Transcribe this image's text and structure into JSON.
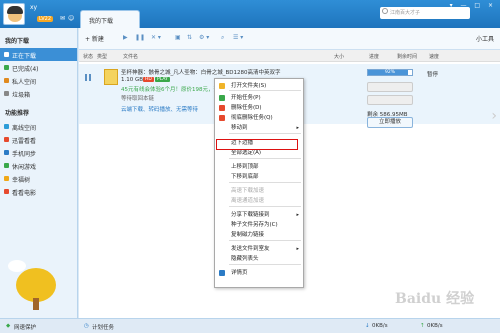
{
  "titlebar": {
    "username": "xy",
    "level": "LV22",
    "tab_label": "我的下载",
    "search_placeholder": "江南百大才子",
    "window_controls": "▾ — □ ×"
  },
  "toolbar": {
    "new_label": "+ 新建",
    "tools_label": "小工具"
  },
  "columns": {
    "status": "状态",
    "type": "类型",
    "filename": "文件名",
    "size": "大小",
    "progress": "进度",
    "remaining": "剩余时间",
    "speed": "速度"
  },
  "sidebar": {
    "section1": "我的下载",
    "items": [
      {
        "label": "正在下载",
        "icon": "download-icon",
        "color": "#2b7bc5"
      },
      {
        "label": "已完成(4)",
        "icon": "check-icon",
        "color": "#3aa84a"
      },
      {
        "label": "私人空间",
        "icon": "lock-icon",
        "color": "#e08a1e"
      },
      {
        "label": "垃圾箱",
        "icon": "trash-icon",
        "color": "#888888"
      }
    ],
    "section2": "功能推荐",
    "features": [
      {
        "label": "离线空间",
        "icon": "cloud-icon",
        "color": "#2b9cd8"
      },
      {
        "label": "迅雷看看",
        "icon": "play-icon",
        "color": "#e6492d"
      },
      {
        "label": "手机同步",
        "icon": "phone-icon",
        "color": "#2b7bc5"
      },
      {
        "label": "休闲游戏",
        "icon": "game-icon",
        "color": "#3aa84a"
      },
      {
        "label": "幸福树",
        "icon": "tree-icon",
        "color": "#f0a818"
      },
      {
        "label": "看看电影",
        "icon": "movie-icon",
        "color": "#e6492d"
      }
    ]
  },
  "task": {
    "title": "圣杯神器：骸骨之城_凡人圣物：白骨之城_BD1280高清中英双字",
    "size": "1.10 GB",
    "tag_hd": "HD",
    "tag_play": "PLAY",
    "line1": "45元有线会体验6个月！原价198元，预约",
    "line2": "等待取回本链",
    "line3": "云端下载、转码播放、无需等待",
    "progress_percent": 92,
    "progress_text": "92%",
    "status": "暂停",
    "remaining": "剩余 586.95MB",
    "play_label": "立即播放"
  },
  "context_menu": {
    "items": [
      {
        "label": "打开文件夹(S)",
        "disabled": false,
        "icon": "folder-icon"
      },
      {
        "label": "开始任务(P)",
        "disabled": false,
        "icon": "play-icon"
      },
      {
        "label": "删除任务(D)",
        "disabled": false,
        "icon": "delete-icon"
      },
      {
        "label": "彻底删除任务(Q)",
        "disabled": false,
        "icon": "delete-all-icon"
      },
      {
        "label": "移动到",
        "disabled": false,
        "icon": "",
        "submenu": true
      },
      {
        "label": "边下边播",
        "disabled": false,
        "icon": "",
        "highlighted": true
      },
      {
        "label": "全部选定(A)",
        "disabled": false,
        "icon": ""
      },
      {
        "label": "上移到顶部",
        "disabled": false,
        "icon": ""
      },
      {
        "label": "下移到底部",
        "disabled": false,
        "icon": ""
      },
      {
        "label": "高速下载加速",
        "disabled": true,
        "icon": ""
      },
      {
        "label": "离速通道加速",
        "disabled": true,
        "icon": ""
      },
      {
        "label": "分享下载链接到",
        "disabled": false,
        "icon": "",
        "submenu": true
      },
      {
        "label": "种子文件另存为(C)",
        "disabled": false,
        "icon": ""
      },
      {
        "label": "复制磁力链接",
        "disabled": false,
        "icon": ""
      },
      {
        "label": "发送文件到室友",
        "disabled": false,
        "icon": "",
        "submenu": true
      },
      {
        "label": "隐藏列表头",
        "disabled": false,
        "icon": ""
      },
      {
        "label": "详情页",
        "disabled": false,
        "icon": "detail-icon"
      }
    ]
  },
  "statusbar": {
    "network": "网速保护",
    "plan": "计划任务",
    "down_speed": "0KB/s",
    "up_speed": "0KB/s"
  },
  "watermark": "Baidu 经验"
}
